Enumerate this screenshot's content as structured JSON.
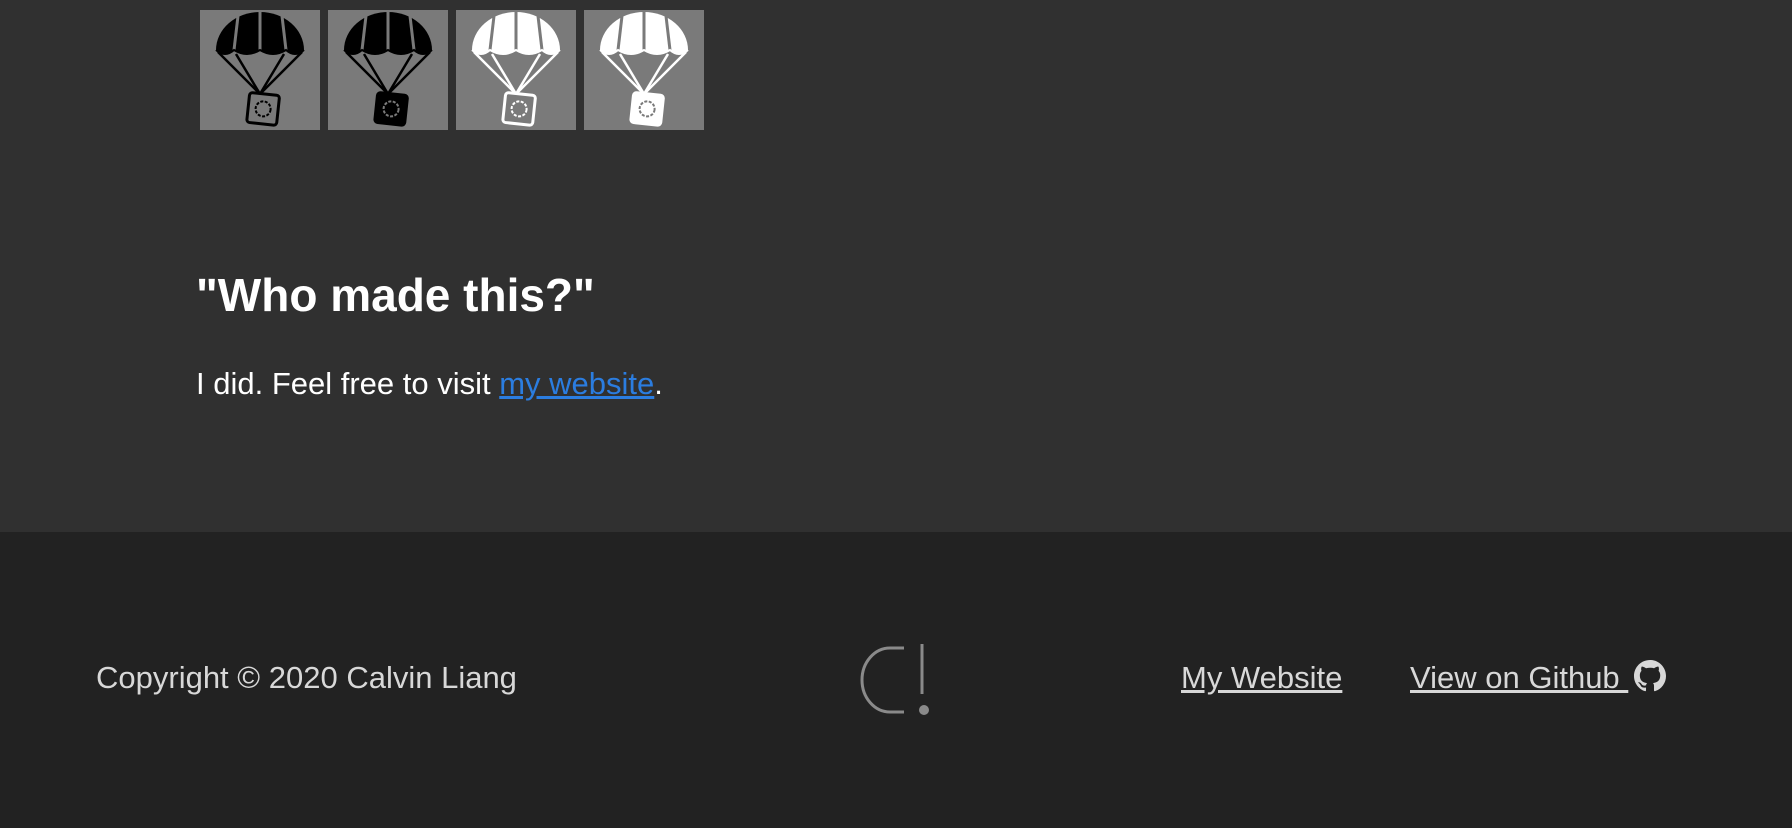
{
  "icons": [
    {
      "name": "parachute-icon-black-outline",
      "parachute_color": "#000000",
      "box_fill": "#7a7a7a"
    },
    {
      "name": "parachute-icon-black-filled",
      "parachute_color": "#000000",
      "box_fill": "#000000"
    },
    {
      "name": "parachute-icon-white-outline",
      "parachute_color": "#ffffff",
      "box_fill": "#7a7a7a"
    },
    {
      "name": "parachute-icon-white-filled",
      "parachute_color": "#ffffff",
      "box_fill": "#ffffff"
    }
  ],
  "section": {
    "heading": "\"Who made this?\"",
    "text_before": "I did. Feel free to visit ",
    "link_text": "my website",
    "text_after": "."
  },
  "footer": {
    "copyright": "Copyright © 2020 Calvin Liang",
    "logo_icon": "calvin-liang-logo-icon",
    "links": {
      "website": "My Website",
      "github": "View on Github "
    },
    "github_icon": "github-icon"
  },
  "colors": {
    "background": "#303030",
    "footer_background": "#222222",
    "link": "#2b7de0",
    "footer_text": "#d8d8d8",
    "tile": "#7a7a7a"
  }
}
